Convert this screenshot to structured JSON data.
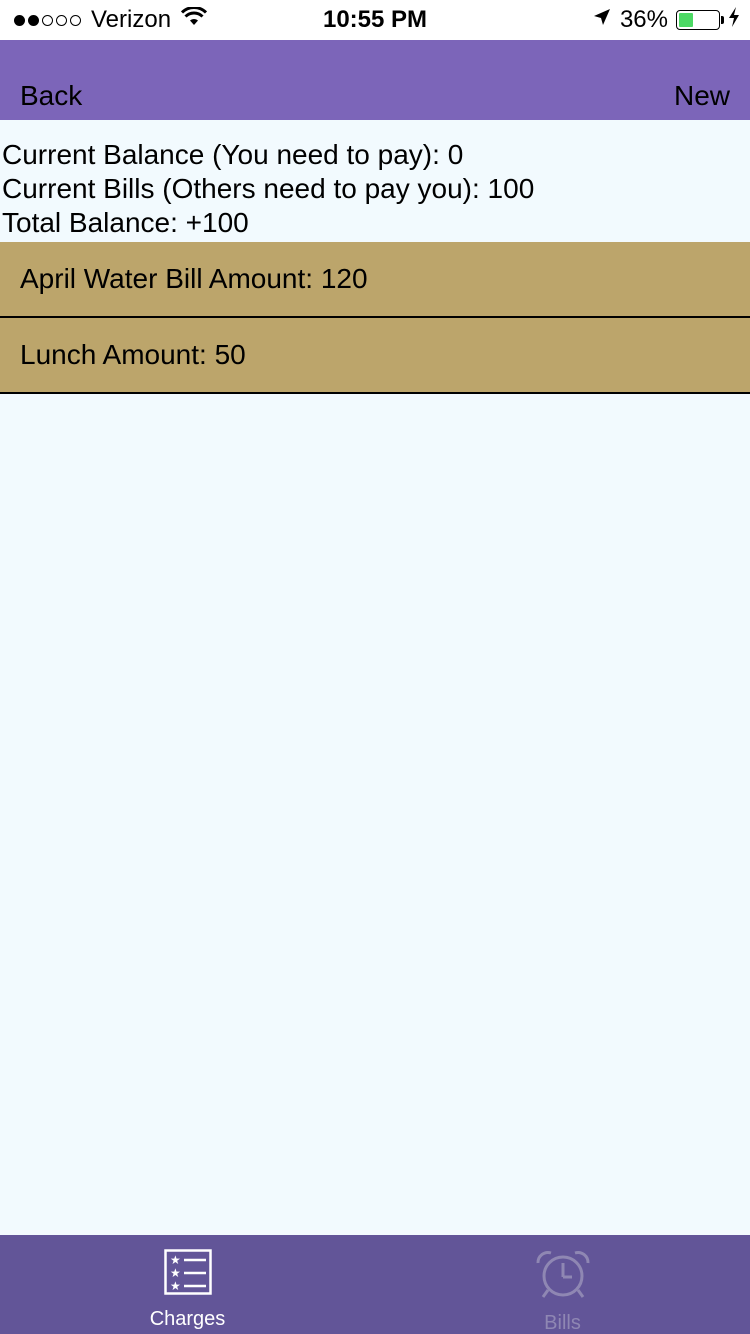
{
  "status_bar": {
    "carrier": "Verizon",
    "time": "10:55 PM",
    "battery_percent": "36%",
    "battery_level": 0.36,
    "signal_bars_filled": 2,
    "signal_bars_total": 5
  },
  "nav": {
    "back_label": "Back",
    "new_label": "New"
  },
  "summary": {
    "current_balance": "Current Balance (You need to pay): 0",
    "current_bills": "Current Bills (Others need to pay you): 100",
    "total_balance": "Total Balance: +100"
  },
  "charges": [
    {
      "label": "April Water Bill Amount: 120"
    },
    {
      "label": "Lunch Amount: 50"
    }
  ],
  "tabs": [
    {
      "label": "Charges",
      "icon": "list-icon",
      "active": true
    },
    {
      "label": "Bills",
      "icon": "alarm-clock-icon",
      "active": false
    }
  ],
  "colors": {
    "nav_bar": "#7c65b9",
    "tab_bar": "#625598",
    "list_item": "#bca56b",
    "background": "#f2fafe",
    "battery": "#4cd964"
  }
}
